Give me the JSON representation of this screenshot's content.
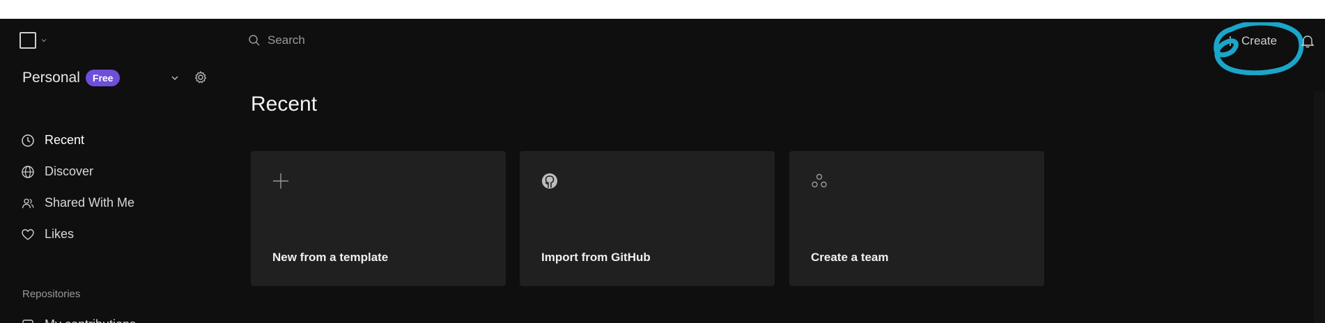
{
  "header": {
    "search_placeholder": "Search",
    "create_label": "Create"
  },
  "sidebar": {
    "workspace_name": "Personal",
    "plan_badge": "Free",
    "items": [
      {
        "label": "Recent",
        "icon": "clock-icon"
      },
      {
        "label": "Discover",
        "icon": "globe-icon"
      },
      {
        "label": "Shared With Me",
        "icon": "users-icon"
      },
      {
        "label": "Likes",
        "icon": "heart-icon"
      }
    ],
    "section_repositories": "Repositories",
    "partial_item": "My contributions"
  },
  "main": {
    "title": "Recent",
    "cards": [
      {
        "label": "New from a template",
        "icon": "plus-icon"
      },
      {
        "label": "Import from GitHub",
        "icon": "github-icon"
      },
      {
        "label": "Create a team",
        "icon": "team-icon"
      }
    ]
  },
  "colors": {
    "background": "#0f0f0f",
    "card": "#202020",
    "badge": "#6d4fdb",
    "annotation": "#1aa6c9"
  }
}
